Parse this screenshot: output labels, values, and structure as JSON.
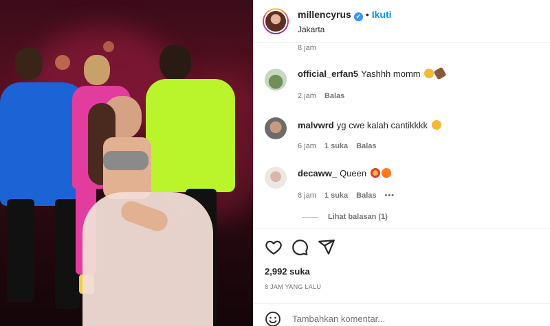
{
  "post": {
    "owner": "millencyrus",
    "follow_label": "Ikuti",
    "separator": "•",
    "location": "Jakarta",
    "verified": true
  },
  "comments": {
    "top_time": "8 jam",
    "items": [
      {
        "user": "official_erfan5",
        "text": "Yashhh momm",
        "time": "2 jam",
        "likes": "",
        "reply": "Balas",
        "emojis": [
          "face-with-tongue",
          "flexed-biceps"
        ]
      },
      {
        "user": "malvwrd",
        "text": "yg cwe kalah cantikkkk",
        "time": "6 jam",
        "likes": "1 suka",
        "reply": "Balas",
        "emojis": [
          "zany-face"
        ]
      },
      {
        "user": "decaww_",
        "text": "Queen",
        "time": "8 jam",
        "likes": "1 suka",
        "reply": "Balas",
        "more": "•••",
        "emojis": [
          "heart-eyes",
          "fire"
        ]
      }
    ],
    "view_replies": "Lihat balasan (1)"
  },
  "actions": {
    "like_icon": "heart-icon",
    "comment_icon": "comment-icon",
    "share_icon": "share-icon",
    "likes_count": "2,992 suka",
    "posted_ago": "8 JAM YANG LALU"
  },
  "add_comment": {
    "placeholder": "Tambahkan komentar..."
  },
  "colors": {
    "accent_blue": "#0095f6",
    "muted_text": "#737373",
    "border": "#efefef"
  }
}
